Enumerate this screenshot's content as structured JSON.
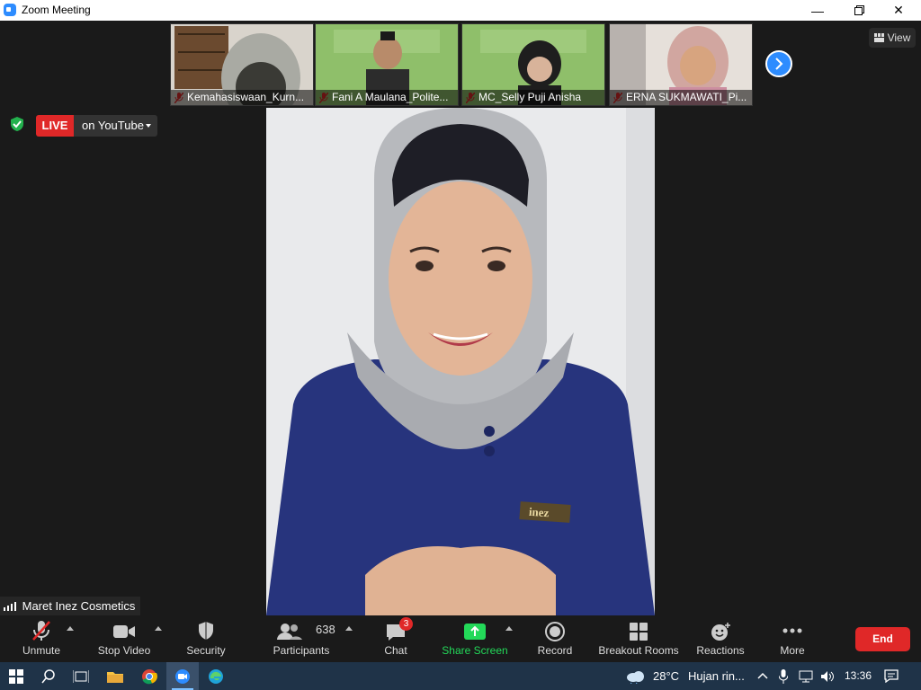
{
  "window": {
    "title": "Zoom Meeting"
  },
  "participants_strip": [
    {
      "name": "Kemahasiswaan_Kurn...",
      "bg": "#d9d4cc"
    },
    {
      "name": "Fani A Maulana_Polite...",
      "bg": "#8fbf6a"
    },
    {
      "name": "MC_Selly Puji Anisha",
      "bg": "#8fbf6a"
    },
    {
      "name": "ERNA SUKMAWATI_Pi...",
      "bg": "#e6e0da"
    }
  ],
  "view_label": "View",
  "live": {
    "badge": "LIVE",
    "platform": "on YouTube"
  },
  "speaker": {
    "name": "Maret Inez Cosmetics",
    "badge_text": "inez"
  },
  "toolbar": {
    "unmute": "Unmute",
    "stop_video": "Stop Video",
    "security": "Security",
    "participants": "Participants",
    "participants_count": "638",
    "chat": "Chat",
    "chat_unread": "3",
    "share_screen": "Share Screen",
    "record": "Record",
    "breakout_rooms": "Breakout Rooms",
    "reactions": "Reactions",
    "more": "More",
    "end": "End"
  },
  "taskbar": {
    "weather_temp": "28°C",
    "weather_text": "Hujan rin...",
    "time": "13:36"
  },
  "colors": {
    "accent": "#2d8cff",
    "danger": "#e02828",
    "share": "#23d959"
  }
}
